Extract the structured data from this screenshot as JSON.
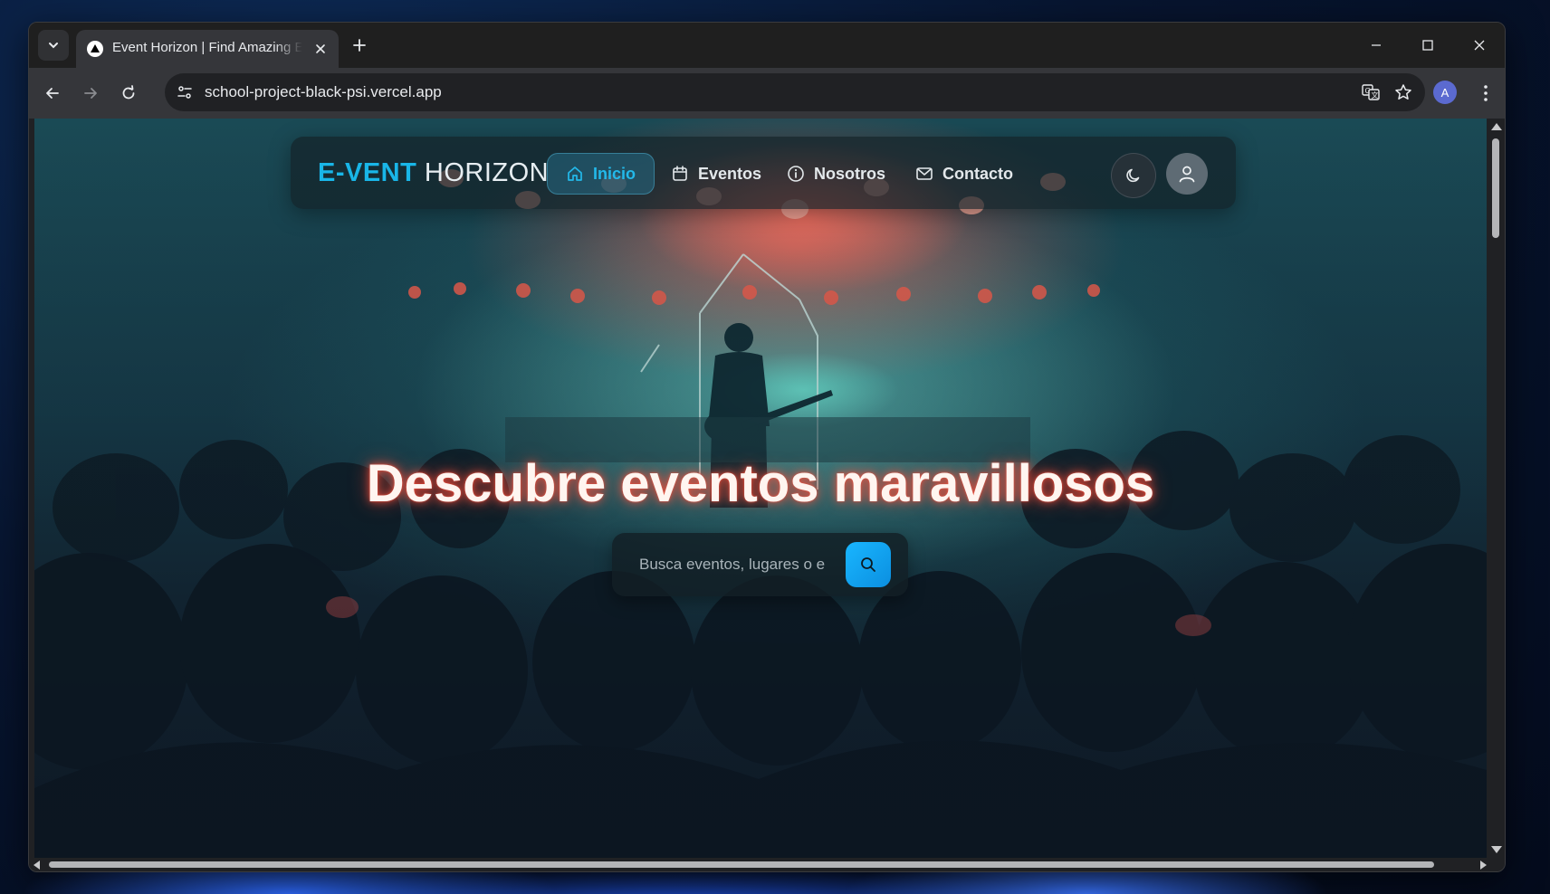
{
  "browser": {
    "tab_title": "Event Horizon | Find Amazing Events",
    "url": "school-project-black-psi.vercel.app",
    "profile_initial": "A"
  },
  "site": {
    "logo_accent": "E-VENT",
    "logo_rest": "HORIZON",
    "nav": [
      {
        "label": "Inicio",
        "active": true
      },
      {
        "label": "Eventos",
        "active": false
      },
      {
        "label": "Nosotros",
        "active": false
      },
      {
        "label": "Contacto",
        "active": false
      }
    ]
  },
  "hero": {
    "title": "Descubre eventos maravillosos",
    "search_placeholder": "Busca eventos, lugares o e"
  },
  "colors": {
    "accent": "#19b6e8",
    "title_glow": "#ff5a3c"
  }
}
